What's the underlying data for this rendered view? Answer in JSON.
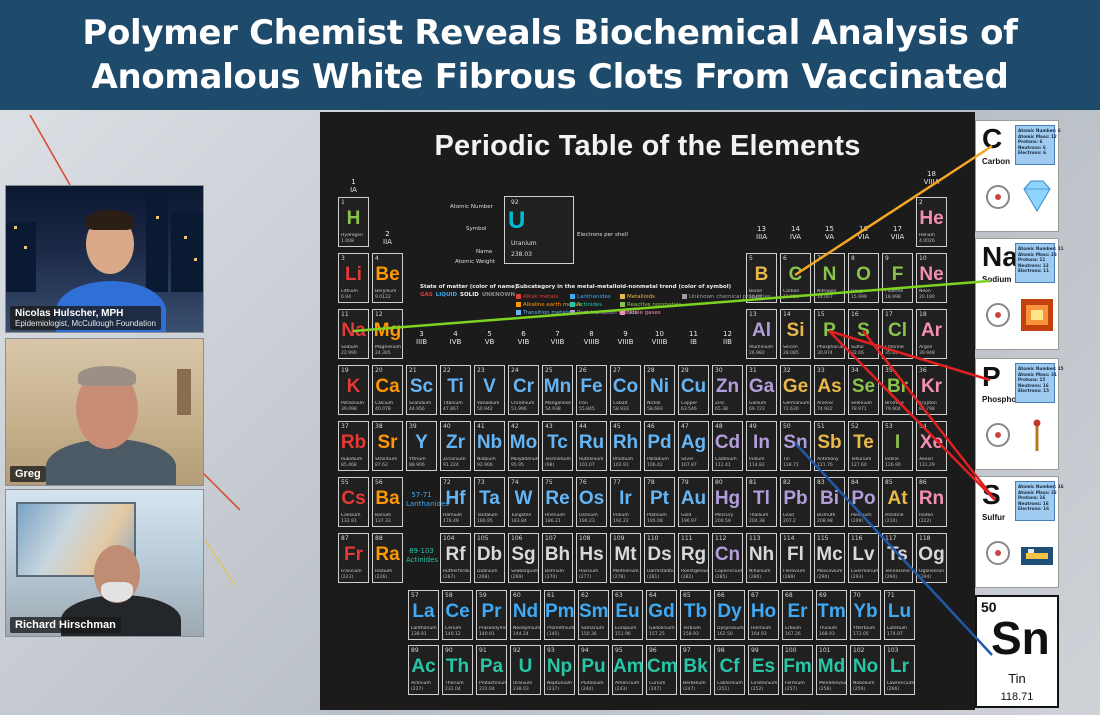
{
  "headline": {
    "line1": "Polymer Chemist Reveals Biochemical Analysis of",
    "line2": "Anomalous White Fibrous Clots From Vaccinated"
  },
  "participants": [
    {
      "name": "Nicolas Hulscher, MPH",
      "title": "Epidemiologist, McCullough Foundation"
    },
    {
      "name": "Greg"
    },
    {
      "name": "Richard Hirschman"
    }
  ],
  "slide": {
    "title": "Periodic Table of the Elements",
    "legend": {
      "atomic_number_label": "Atomic Number",
      "symbol_label": "Symbol",
      "name_label": "Name",
      "weight_label": "Atomic Weight",
      "electrons_label": "Electrons per shell",
      "sample_number": "92",
      "sample_symbol": "U",
      "sample_name": "Uranium",
      "sample_weight": "238.03"
    },
    "state_heading": "State of matter (color of name)",
    "states": [
      "GAS",
      "LIQUID",
      "SOLID",
      "UNKNOWN"
    ],
    "category_heading": "Subcategory in the metal-metalloid-nonmetal trend (color of symbol)",
    "categories": [
      {
        "label": "Alkali metals",
        "color": "#e53935"
      },
      {
        "label": "Lanthanides",
        "color": "#3fa9f5"
      },
      {
        "label": "Metalloids",
        "color": "#e8b84a"
      },
      {
        "label": "Unknown chemical properties",
        "color": "#9e9e9e"
      },
      {
        "label": "Alkaline earth metals",
        "color": "#ff9800"
      },
      {
        "label": "Actinides",
        "color": "#26c6a6"
      },
      {
        "label": "Reactive nonmetals",
        "color": "#8bc34a"
      },
      {
        "label": "Transition metals",
        "color": "#64b5f6"
      },
      {
        "label": "Post-transition metals",
        "color": "#b39ddb"
      },
      {
        "label": "Noble gases",
        "color": "#f48fb1"
      }
    ],
    "group_labels": [
      "1",
      "IA",
      "2",
      "IIA",
      "3",
      "IIIB",
      "4",
      "IVB",
      "5",
      "VB",
      "6",
      "VIB",
      "7",
      "VIIB",
      "8",
      "VIIIB",
      "9",
      "VIIIB",
      "10",
      "VIIIB",
      "11",
      "IB",
      "12",
      "IIB",
      "13",
      "IIIA",
      "14",
      "IVA",
      "15",
      "VA",
      "16",
      "VIA",
      "17",
      "VIIA",
      "18",
      "VIIIA"
    ],
    "lanthanide_series": "57-71 Lanthanides",
    "actinide_series": "89-103 Actinides"
  },
  "elements": [
    {
      "n": "1",
      "s": "H",
      "name": "Hydrogen",
      "w": "1.008",
      "c": "#8bc34a"
    },
    {
      "n": "2",
      "s": "He",
      "name": "Helium",
      "w": "4.0026",
      "c": "#f48fb1"
    },
    {
      "n": "3",
      "s": "Li",
      "name": "Lithium",
      "w": "6.94",
      "c": "#e53935"
    },
    {
      "n": "4",
      "s": "Be",
      "name": "Beryllium",
      "w": "9.0122",
      "c": "#ff9800"
    },
    {
      "n": "5",
      "s": "B",
      "name": "Boron",
      "w": "10.81",
      "c": "#e8b84a"
    },
    {
      "n": "6",
      "s": "C",
      "name": "Carbon",
      "w": "12.011",
      "c": "#8bc34a"
    },
    {
      "n": "7",
      "s": "N",
      "name": "Nitrogen",
      "w": "14.007",
      "c": "#8bc34a"
    },
    {
      "n": "8",
      "s": "O",
      "name": "Oxygen",
      "w": "15.999",
      "c": "#8bc34a"
    },
    {
      "n": "9",
      "s": "F",
      "name": "Fluorine",
      "w": "18.998",
      "c": "#8bc34a"
    },
    {
      "n": "10",
      "s": "Ne",
      "name": "Neon",
      "w": "20.180",
      "c": "#f48fb1"
    },
    {
      "n": "11",
      "s": "Na",
      "name": "Sodium",
      "w": "22.990",
      "c": "#e53935"
    },
    {
      "n": "12",
      "s": "Mg",
      "name": "Magnesium",
      "w": "24.305",
      "c": "#ff9800"
    },
    {
      "n": "13",
      "s": "Al",
      "name": "Aluminium",
      "w": "26.982",
      "c": "#b39ddb"
    },
    {
      "n": "14",
      "s": "Si",
      "name": "Silicon",
      "w": "28.085",
      "c": "#e8b84a"
    },
    {
      "n": "15",
      "s": "P",
      "name": "Phosphorus",
      "w": "30.974",
      "c": "#8bc34a"
    },
    {
      "n": "16",
      "s": "S",
      "name": "Sulfur",
      "w": "32.06",
      "c": "#8bc34a"
    },
    {
      "n": "17",
      "s": "Cl",
      "name": "Chlorine",
      "w": "35.45",
      "c": "#8bc34a"
    },
    {
      "n": "18",
      "s": "Ar",
      "name": "Argon",
      "w": "39.948",
      "c": "#f48fb1"
    },
    {
      "n": "19",
      "s": "K",
      "name": "Potassium",
      "w": "39.098",
      "c": "#e53935"
    },
    {
      "n": "20",
      "s": "Ca",
      "name": "Calcium",
      "w": "40.078",
      "c": "#ff9800"
    },
    {
      "n": "21",
      "s": "Sc",
      "name": "Scandium",
      "w": "44.956",
      "c": "#64b5f6"
    },
    {
      "n": "22",
      "s": "Ti",
      "name": "Titanium",
      "w": "47.867",
      "c": "#64b5f6"
    },
    {
      "n": "23",
      "s": "V",
      "name": "Vanadium",
      "w": "50.942",
      "c": "#64b5f6"
    },
    {
      "n": "24",
      "s": "Cr",
      "name": "Chromium",
      "w": "51.996",
      "c": "#64b5f6"
    },
    {
      "n": "25",
      "s": "Mn",
      "name": "Manganese",
      "w": "54.938",
      "c": "#64b5f6"
    },
    {
      "n": "26",
      "s": "Fe",
      "name": "Iron",
      "w": "55.845",
      "c": "#64b5f6"
    },
    {
      "n": "27",
      "s": "Co",
      "name": "Cobalt",
      "w": "58.933",
      "c": "#64b5f6"
    },
    {
      "n": "28",
      "s": "Ni",
      "name": "Nickel",
      "w": "58.693",
      "c": "#64b5f6"
    },
    {
      "n": "29",
      "s": "Cu",
      "name": "Copper",
      "w": "63.546",
      "c": "#64b5f6"
    },
    {
      "n": "30",
      "s": "Zn",
      "name": "Zinc",
      "w": "65.38",
      "c": "#b39ddb"
    },
    {
      "n": "31",
      "s": "Ga",
      "name": "Gallium",
      "w": "69.723",
      "c": "#b39ddb"
    },
    {
      "n": "32",
      "s": "Ge",
      "name": "Germanium",
      "w": "72.630",
      "c": "#e8b84a"
    },
    {
      "n": "33",
      "s": "As",
      "name": "Arsenic",
      "w": "74.922",
      "c": "#e8b84a"
    },
    {
      "n": "34",
      "s": "Se",
      "name": "Selenium",
      "w": "78.971",
      "c": "#8bc34a"
    },
    {
      "n": "35",
      "s": "Br",
      "name": "Bromine",
      "w": "79.904",
      "c": "#8bc34a"
    },
    {
      "n": "36",
      "s": "Kr",
      "name": "Krypton",
      "w": "83.798",
      "c": "#f48fb1"
    },
    {
      "n": "37",
      "s": "Rb",
      "name": "Rubidium",
      "w": "85.468",
      "c": "#e53935"
    },
    {
      "n": "38",
      "s": "Sr",
      "name": "Strontium",
      "w": "87.62",
      "c": "#ff9800"
    },
    {
      "n": "39",
      "s": "Y",
      "name": "Yttrium",
      "w": "88.906",
      "c": "#64b5f6"
    },
    {
      "n": "40",
      "s": "Zr",
      "name": "Zirconium",
      "w": "91.224",
      "c": "#64b5f6"
    },
    {
      "n": "41",
      "s": "Nb",
      "name": "Niobium",
      "w": "92.906",
      "c": "#64b5f6"
    },
    {
      "n": "42",
      "s": "Mo",
      "name": "Molybdenum",
      "w": "95.95",
      "c": "#64b5f6"
    },
    {
      "n": "43",
      "s": "Tc",
      "name": "Technetium",
      "w": "(98)",
      "c": "#64b5f6"
    },
    {
      "n": "44",
      "s": "Ru",
      "name": "Ruthenium",
      "w": "101.07",
      "c": "#64b5f6"
    },
    {
      "n": "45",
      "s": "Rh",
      "name": "Rhodium",
      "w": "102.91",
      "c": "#64b5f6"
    },
    {
      "n": "46",
      "s": "Pd",
      "name": "Palladium",
      "w": "106.42",
      "c": "#64b5f6"
    },
    {
      "n": "47",
      "s": "Ag",
      "name": "Silver",
      "w": "107.87",
      "c": "#64b5f6"
    },
    {
      "n": "48",
      "s": "Cd",
      "name": "Cadmium",
      "w": "112.41",
      "c": "#b39ddb"
    },
    {
      "n": "49",
      "s": "In",
      "name": "Indium",
      "w": "114.82",
      "c": "#b39ddb"
    },
    {
      "n": "50",
      "s": "Sn",
      "name": "Tin",
      "w": "118.71",
      "c": "#b39ddb"
    },
    {
      "n": "51",
      "s": "Sb",
      "name": "Antimony",
      "w": "121.76",
      "c": "#e8b84a"
    },
    {
      "n": "52",
      "s": "Te",
      "name": "Tellurium",
      "w": "127.60",
      "c": "#e8b84a"
    },
    {
      "n": "53",
      "s": "I",
      "name": "Iodine",
      "w": "126.90",
      "c": "#8bc34a"
    },
    {
      "n": "54",
      "s": "Xe",
      "name": "Xenon",
      "w": "131.29",
      "c": "#f48fb1"
    },
    {
      "n": "55",
      "s": "Cs",
      "name": "Caesium",
      "w": "132.91",
      "c": "#e53935"
    },
    {
      "n": "56",
      "s": "Ba",
      "name": "Barium",
      "w": "137.33",
      "c": "#ff9800"
    },
    {
      "n": "72",
      "s": "Hf",
      "name": "Hafnium",
      "w": "178.49",
      "c": "#64b5f6"
    },
    {
      "n": "73",
      "s": "Ta",
      "name": "Tantalum",
      "w": "180.95",
      "c": "#64b5f6"
    },
    {
      "n": "74",
      "s": "W",
      "name": "Tungsten",
      "w": "183.84",
      "c": "#64b5f6"
    },
    {
      "n": "75",
      "s": "Re",
      "name": "Rhenium",
      "w": "186.21",
      "c": "#64b5f6"
    },
    {
      "n": "76",
      "s": "Os",
      "name": "Osmium",
      "w": "190.23",
      "c": "#64b5f6"
    },
    {
      "n": "77",
      "s": "Ir",
      "name": "Iridium",
      "w": "192.22",
      "c": "#64b5f6"
    },
    {
      "n": "78",
      "s": "Pt",
      "name": "Platinum",
      "w": "195.08",
      "c": "#64b5f6"
    },
    {
      "n": "79",
      "s": "Au",
      "name": "Gold",
      "w": "196.97",
      "c": "#64b5f6"
    },
    {
      "n": "80",
      "s": "Hg",
      "name": "Mercury",
      "w": "200.59",
      "c": "#b39ddb"
    },
    {
      "n": "81",
      "s": "Tl",
      "name": "Thallium",
      "w": "204.38",
      "c": "#b39ddb"
    },
    {
      "n": "82",
      "s": "Pb",
      "name": "Lead",
      "w": "207.2",
      "c": "#b39ddb"
    },
    {
      "n": "83",
      "s": "Bi",
      "name": "Bismuth",
      "w": "208.98",
      "c": "#b39ddb"
    },
    {
      "n": "84",
      "s": "Po",
      "name": "Polonium",
      "w": "(209)",
      "c": "#b39ddb"
    },
    {
      "n": "85",
      "s": "At",
      "name": "Astatine",
      "w": "(210)",
      "c": "#e8b84a"
    },
    {
      "n": "86",
      "s": "Rn",
      "name": "Radon",
      "w": "(222)",
      "c": "#f48fb1"
    },
    {
      "n": "87",
      "s": "Fr",
      "name": "Francium",
      "w": "(223)",
      "c": "#e53935"
    },
    {
      "n": "88",
      "s": "Ra",
      "name": "Radium",
      "w": "(226)",
      "c": "#ff9800"
    },
    {
      "n": "104",
      "s": "Rf",
      "name": "Rutherfordium",
      "w": "(267)",
      "c": "#d9d9d9"
    },
    {
      "n": "105",
      "s": "Db",
      "name": "Dubnium",
      "w": "(268)",
      "c": "#d9d9d9"
    },
    {
      "n": "106",
      "s": "Sg",
      "name": "Seaborgium",
      "w": "(269)",
      "c": "#d9d9d9"
    },
    {
      "n": "107",
      "s": "Bh",
      "name": "Bohrium",
      "w": "(270)",
      "c": "#d9d9d9"
    },
    {
      "n": "108",
      "s": "Hs",
      "name": "Hassium",
      "w": "(277)",
      "c": "#d9d9d9"
    },
    {
      "n": "109",
      "s": "Mt",
      "name": "Meitnerium",
      "w": "(278)",
      "c": "#d9d9d9"
    },
    {
      "n": "110",
      "s": "Ds",
      "name": "Darmstadtium",
      "w": "(281)",
      "c": "#d9d9d9"
    },
    {
      "n": "111",
      "s": "Rg",
      "name": "Roentgenium",
      "w": "(282)",
      "c": "#d9d9d9"
    },
    {
      "n": "112",
      "s": "Cn",
      "name": "Copernicium",
      "w": "(285)",
      "c": "#b39ddb"
    },
    {
      "n": "113",
      "s": "Nh",
      "name": "Nihonium",
      "w": "(286)",
      "c": "#d9d9d9"
    },
    {
      "n": "114",
      "s": "Fl",
      "name": "Flerovium",
      "w": "(289)",
      "c": "#d9d9d9"
    },
    {
      "n": "115",
      "s": "Mc",
      "name": "Moscovium",
      "w": "(290)",
      "c": "#d9d9d9"
    },
    {
      "n": "116",
      "s": "Lv",
      "name": "Livermorium",
      "w": "(293)",
      "c": "#d9d9d9"
    },
    {
      "n": "117",
      "s": "Ts",
      "name": "Tennessine",
      "w": "(294)",
      "c": "#d9d9d9"
    },
    {
      "n": "118",
      "s": "Og",
      "name": "Oganesson",
      "w": "(294)",
      "c": "#d9d9d9"
    }
  ],
  "lanthanides": [
    {
      "n": "57",
      "s": "La",
      "name": "Lanthanum",
      "w": "138.91"
    },
    {
      "n": "58",
      "s": "Ce",
      "name": "Cerium",
      "w": "140.12"
    },
    {
      "n": "59",
      "s": "Pr",
      "name": "Praseodymium",
      "w": "140.91"
    },
    {
      "n": "60",
      "s": "Nd",
      "name": "Neodymium",
      "w": "144.24"
    },
    {
      "n": "61",
      "s": "Pm",
      "name": "Promethium",
      "w": "(145)"
    },
    {
      "n": "62",
      "s": "Sm",
      "name": "Samarium",
      "w": "150.36"
    },
    {
      "n": "63",
      "s": "Eu",
      "name": "Europium",
      "w": "151.96"
    },
    {
      "n": "64",
      "s": "Gd",
      "name": "Gadolinium",
      "w": "157.25"
    },
    {
      "n": "65",
      "s": "Tb",
      "name": "Terbium",
      "w": "158.93"
    },
    {
      "n": "66",
      "s": "Dy",
      "name": "Dysprosium",
      "w": "162.50"
    },
    {
      "n": "67",
      "s": "Ho",
      "name": "Holmium",
      "w": "164.93"
    },
    {
      "n": "68",
      "s": "Er",
      "name": "Erbium",
      "w": "167.26"
    },
    {
      "n": "69",
      "s": "Tm",
      "name": "Thulium",
      "w": "168.93"
    },
    {
      "n": "70",
      "s": "Yb",
      "name": "Ytterbium",
      "w": "173.05"
    },
    {
      "n": "71",
      "s": "Lu",
      "name": "Lutetium",
      "w": "174.97"
    }
  ],
  "actinides": [
    {
      "n": "89",
      "s": "Ac",
      "name": "Actinium",
      "w": "(227)"
    },
    {
      "n": "90",
      "s": "Th",
      "name": "Thorium",
      "w": "232.04"
    },
    {
      "n": "91",
      "s": "Pa",
      "name": "Protactinium",
      "w": "231.04"
    },
    {
      "n": "92",
      "s": "U",
      "name": "Uranium",
      "w": "238.03"
    },
    {
      "n": "93",
      "s": "Np",
      "name": "Neptunium",
      "w": "(237)"
    },
    {
      "n": "94",
      "s": "Pu",
      "name": "Plutonium",
      "w": "(244)"
    },
    {
      "n": "95",
      "s": "Am",
      "name": "Americium",
      "w": "(243)"
    },
    {
      "n": "96",
      "s": "Cm",
      "name": "Curium",
      "w": "(247)"
    },
    {
      "n": "97",
      "s": "Bk",
      "name": "Berkelium",
      "w": "(247)"
    },
    {
      "n": "98",
      "s": "Cf",
      "name": "Californium",
      "w": "(251)"
    },
    {
      "n": "99",
      "s": "Es",
      "name": "Einsteinium",
      "w": "(252)"
    },
    {
      "n": "100",
      "s": "Fm",
      "name": "Fermium",
      "w": "(257)"
    },
    {
      "n": "101",
      "s": "Md",
      "name": "Mendelevium",
      "w": "(258)"
    },
    {
      "n": "102",
      "s": "No",
      "name": "Nobelium",
      "w": "(259)"
    },
    {
      "n": "103",
      "s": "Lr",
      "name": "Lawrencium",
      "w": "(266)"
    }
  ],
  "cards": [
    {
      "symbol": "C",
      "name": "Carbon",
      "info": [
        "Atomic Number: 6",
        "Atomic Mass: 12",
        "Protons: 6",
        "Neutrons: 6",
        "Electrons: 6"
      ],
      "line_color": "#f5a623",
      "picture": "diamond-icon"
    },
    {
      "symbol": "Na",
      "name": "Sodium",
      "info": [
        "Atomic Number: 11",
        "Atomic Mass: 23",
        "Protons: 11",
        "Neutrons: 12",
        "Electrons: 11"
      ],
      "line_color": "#7ed321",
      "picture": "flame-icon"
    },
    {
      "symbol": "P",
      "name": "Phosphorus",
      "info": [
        "Atomic Number: 15",
        "Atomic Mass: 31",
        "Protons: 15",
        "Neutrons: 16",
        "Electrons: 15"
      ],
      "line_color": "#e02020",
      "picture": "match-icon"
    },
    {
      "symbol": "S",
      "name": "Sulfur",
      "info": [
        "Atomic Number: 16",
        "Atomic Mass: 32",
        "Protons: 16",
        "Neutrons: 16",
        "Electrons: 16"
      ],
      "line_color": "#e02020",
      "picture": "ship-icon"
    }
  ],
  "tin_card": {
    "number": "50",
    "symbol": "Sn",
    "name": "Tin",
    "weight": "118.71",
    "line_color": "#1f5aa8"
  }
}
